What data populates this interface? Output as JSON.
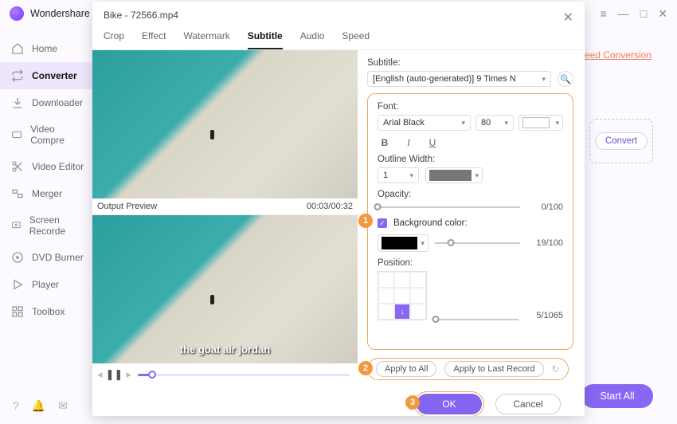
{
  "app": {
    "title": "Wondershare U"
  },
  "window_controls": {
    "menu": "≡",
    "min": "—",
    "max": "□",
    "close": "✕"
  },
  "sidebar": {
    "items": [
      {
        "label": "Home"
      },
      {
        "label": "Converter"
      },
      {
        "label": "Downloader"
      },
      {
        "label": "Video Compre"
      },
      {
        "label": "Video Editor"
      },
      {
        "label": "Merger"
      },
      {
        "label": "Screen Recorde"
      },
      {
        "label": "DVD Burner"
      },
      {
        "label": "Player"
      },
      {
        "label": "Toolbox"
      }
    ]
  },
  "promo": "Speed Conversion",
  "convert_label": "Convert",
  "start_all": "Start All",
  "modal": {
    "file": "Bike - 72566.mp4",
    "tabs": [
      "Crop",
      "Effect",
      "Watermark",
      "Subtitle",
      "Audio",
      "Speed"
    ],
    "output_label": "Output Preview",
    "time": "00:03/00:32",
    "subtitle_text": "the goat air jordan",
    "subtitle_label": "Subtitle:",
    "subtitle_source": "[English (auto-generated)] 9 Times N",
    "font_label": "Font:",
    "font_name": "Arial Black",
    "font_size": "80",
    "outline_label": "Outline Width:",
    "outline_width": "1",
    "opacity_label": "Opacity:",
    "opacity_value": "0/100",
    "bg_label": "Background color:",
    "bg_value": "19/100",
    "position_label": "Position:",
    "position_value": "5/1065",
    "apply_all": "Apply to All",
    "apply_last": "Apply to Last Record",
    "ok": "OK",
    "cancel": "Cancel"
  },
  "annotations": {
    "a1": "1",
    "a2": "2",
    "a3": "3"
  }
}
